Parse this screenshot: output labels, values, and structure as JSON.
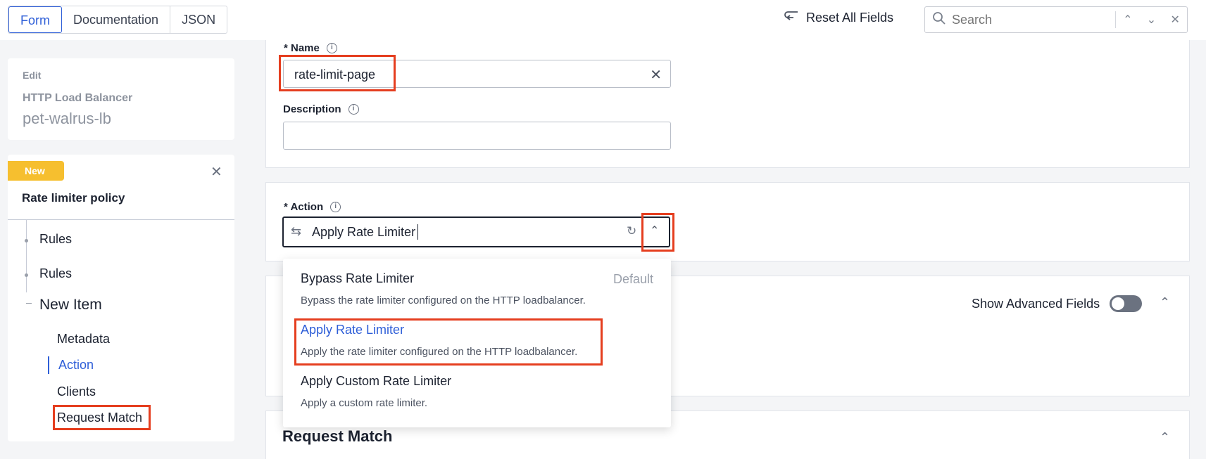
{
  "toolbar": {
    "tabs": [
      "Form",
      "Documentation",
      "JSON"
    ],
    "reset_label": "Reset All Fields",
    "search_placeholder": "Search"
  },
  "sidebar": {
    "edit_label": "Edit",
    "object_type": "HTTP Load Balancer",
    "object_name": "pet-walrus-lb",
    "badge": "New",
    "policy_title": "Rate limiter policy",
    "tree": [
      "Rules",
      "Rules",
      "New Item"
    ],
    "sub_items": [
      "Metadata",
      "Action",
      "Clients",
      "Request Match"
    ],
    "active_sub_item": "Action"
  },
  "form": {
    "name_label": "* Name",
    "name_value": "rate-limit-page",
    "description_label": "Description",
    "description_value": "",
    "action_label": "* Action",
    "action_value": "Apply Rate Limiter",
    "show_advanced_label": "Show Advanced Fields",
    "show_advanced_on": false,
    "request_match_title": "Request Match"
  },
  "dropdown": {
    "options": [
      {
        "title": "Bypass Rate Limiter",
        "desc": "Bypass the rate limiter configured on the HTTP loadbalancer.",
        "tag": "Default"
      },
      {
        "title": "Apply Rate Limiter",
        "desc": "Apply the rate limiter configured on the HTTP loadbalancer.",
        "tag": ""
      },
      {
        "title": "Apply Custom Rate Limiter",
        "desc": "Apply a custom rate limiter.",
        "tag": ""
      }
    ],
    "selected_index": 1
  },
  "colors": {
    "accent": "#2f5fd8",
    "badge": "#f6bf2f",
    "highlight": "#e53e1f"
  }
}
